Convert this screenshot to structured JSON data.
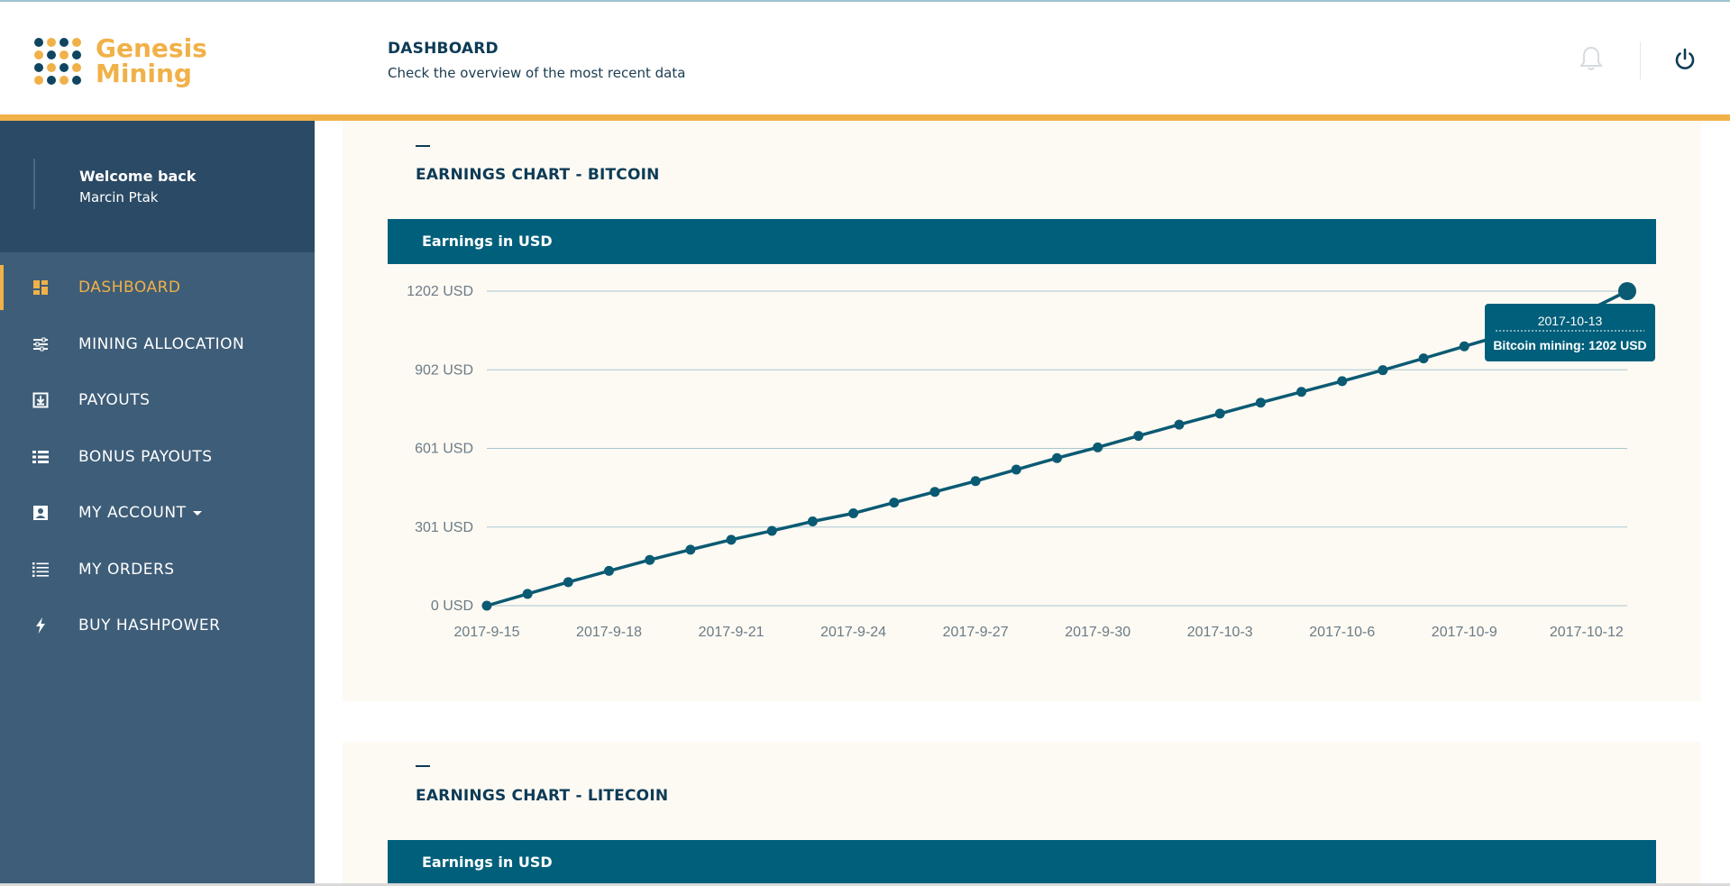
{
  "app": {
    "logo_line1": "Genesis",
    "logo_line2": "Mining",
    "accent": "#f0b148",
    "brand": "#005f7b"
  },
  "header": {
    "title": "DASHBOARD",
    "subtitle": "Check the overview of the most recent data",
    "bell_icon": "bell-icon",
    "power_icon": "power-icon"
  },
  "sidebar": {
    "welcome": "Welcome back",
    "user_name": "Marcin Ptak",
    "items": [
      {
        "label": "DASHBOARD",
        "icon": "dashboard-icon",
        "active": true
      },
      {
        "label": "MINING ALLOCATION",
        "icon": "sliders-icon",
        "active": false
      },
      {
        "label": "PAYOUTS",
        "icon": "download-icon",
        "active": false
      },
      {
        "label": "BONUS PAYOUTS",
        "icon": "list-icon",
        "active": false
      },
      {
        "label": "MY ACCOUNT",
        "icon": "account-icon",
        "active": false
      },
      {
        "label": "MY ORDERS",
        "icon": "orders-icon",
        "active": false
      },
      {
        "label": "BUY HASHPOWER",
        "icon": "bolt-icon",
        "active": false
      }
    ]
  },
  "panels": [
    {
      "title": "EARNINGS CHART - BITCOIN",
      "header": "Earnings in USD"
    },
    {
      "title": "EARNINGS CHART - LITECOIN",
      "header": "Earnings in USD"
    }
  ],
  "tooltip": {
    "date": "2017-10-13",
    "text": "Bitcoin mining: 1202 USD"
  },
  "chart_data": {
    "type": "line",
    "title": "EARNINGS CHART - BITCOIN",
    "subtitle": "Earnings in USD",
    "x": [
      "2017-9-15",
      "2017-9-16",
      "2017-9-17",
      "2017-9-18",
      "2017-9-19",
      "2017-9-20",
      "2017-9-21",
      "2017-9-22",
      "2017-9-23",
      "2017-9-24",
      "2017-9-25",
      "2017-9-26",
      "2017-9-27",
      "2017-9-28",
      "2017-9-29",
      "2017-9-30",
      "2017-10-1",
      "2017-10-2",
      "2017-10-3",
      "2017-10-4",
      "2017-10-5",
      "2017-10-6",
      "2017-10-7",
      "2017-10-8",
      "2017-10-9",
      "2017-10-10",
      "2017-10-11",
      "2017-10-12",
      "2017-10-13"
    ],
    "series": [
      {
        "name": "Bitcoin mining",
        "values": [
          0,
          45,
          90,
          133,
          175,
          214,
          252,
          286,
          322,
          353,
          394,
          435,
          476,
          520,
          564,
          605,
          649,
          692,
          734,
          776,
          817,
          858,
          900,
          945,
          991,
          1036,
          1080,
          1125,
          1202
        ]
      }
    ],
    "y_ticks": [
      "0 USD",
      "301 USD",
      "601 USD",
      "902 USD",
      "1202 USD"
    ],
    "x_ticks": [
      "2017-9-15",
      "2017-9-18",
      "2017-9-21",
      "2017-9-24",
      "2017-9-27",
      "2017-9-30",
      "2017-10-3",
      "2017-10-6",
      "2017-10-9",
      "2017-10-12"
    ],
    "ylim": [
      0,
      1202
    ],
    "grid": true,
    "color": "#0b5a73"
  }
}
